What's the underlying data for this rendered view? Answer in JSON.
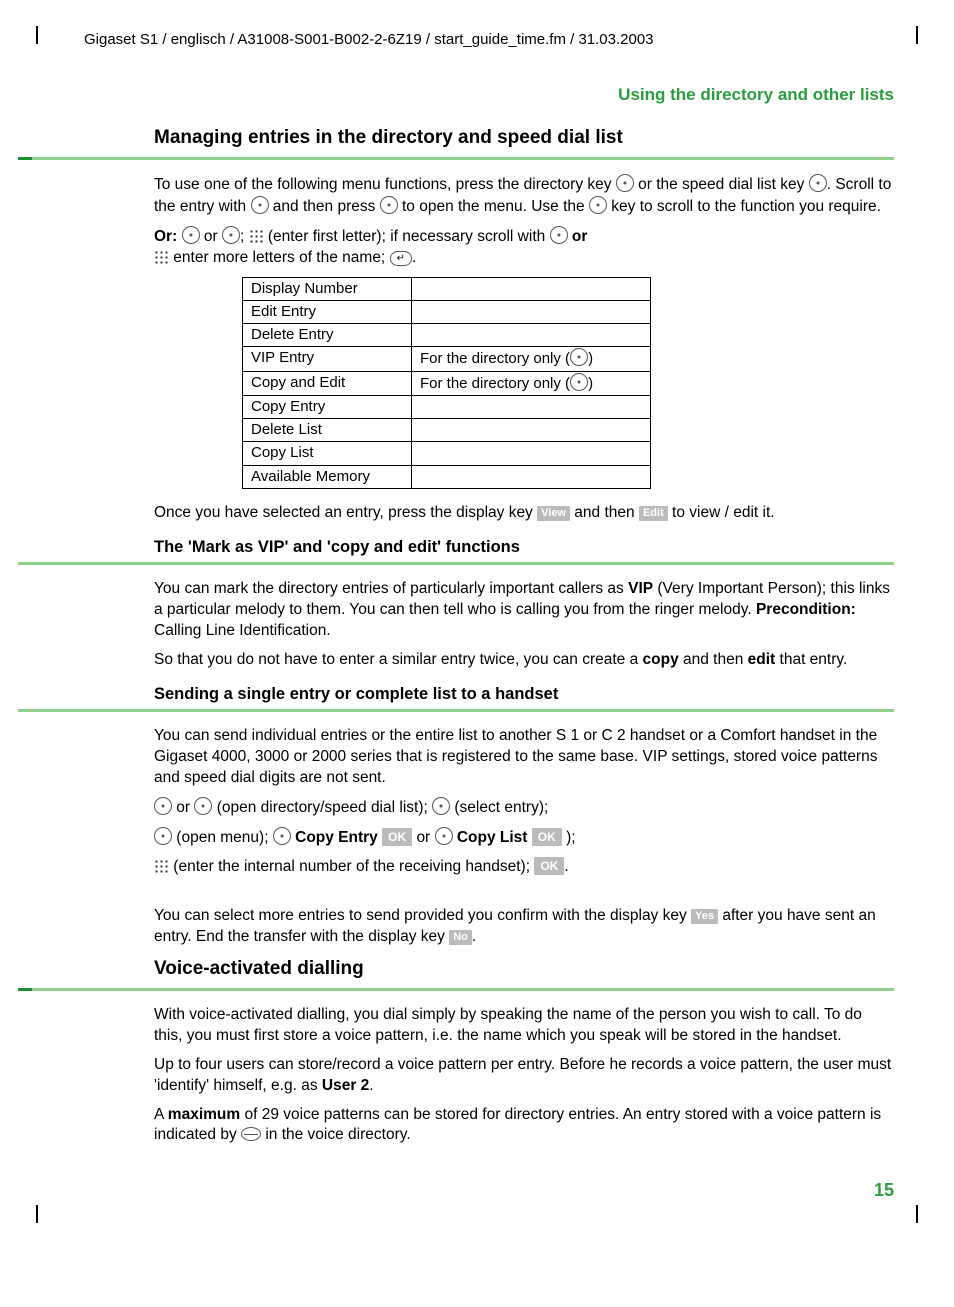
{
  "header_path": "Gigaset S1 / englisch / A31008-S001-B002-2-6Z19 / start_guide_time.fm / 31.03.2003",
  "section_title": "Using the directory and other lists",
  "h1": "Managing entries in the directory and speed dial list",
  "p1a": "To use one of the following menu functions, press the directory key ",
  "p1b": " or the speed dial list key ",
  "p1c": ". Scroll to the entry with ",
  "p1d": " and then press ",
  "p1e": " to open the menu. Use the ",
  "p1f": " key to scroll to the function you require.",
  "p2_or": "Or:",
  "p2a": " or ",
  "p2b": "; ",
  "p2c": " (enter first letter); if necessary scroll with ",
  "p2d": " or",
  "p3a": " enter more letters of the name; ",
  "table": {
    "rows": [
      {
        "c1": "Display Number",
        "c2": ""
      },
      {
        "c1": "Edit Entry",
        "c2": ""
      },
      {
        "c1": "Delete Entry",
        "c2": ""
      },
      {
        "c1": "VIP Entry",
        "c2": "For the directory only ("
      },
      {
        "c1": "Copy and Edit",
        "c2": "For the directory only ("
      },
      {
        "c1": "Copy Entry",
        "c2": ""
      },
      {
        "c1": "Delete List",
        "c2": ""
      },
      {
        "c1": "Copy List",
        "c2": ""
      },
      {
        "c1": "Available Memory",
        "c2": ""
      }
    ]
  },
  "p4a": "Once you have selected an entry, press the display key ",
  "p4_view": "View",
  "p4b": " and then ",
  "p4_edit": "Edit",
  "p4c": " to view / edit it.",
  "h2": "The 'Mark as VIP' and 'copy and edit' functions",
  "p5a": "You can mark the directory entries of particularly important callers as ",
  "p5_vip": "VIP",
  "p5b": " (Very Important Person); this links a particular melody to them. You can then tell who is calling you from the ringer melody. ",
  "p5_pre": "Precondition:",
  "p5c": " Calling Line Identification.",
  "p6a": "So that you do not have to enter a similar entry twice, you can create a ",
  "p6_copy": "copy",
  "p6b": " and then ",
  "p6_edit": "edit",
  "p6c": " that entry.",
  "h3": "Sending a single entry or complete list to a handset",
  "p7": "You can send individual entries or the entire list to another S 1 or C 2 handset or a Comfort handset in the Gigaset 4000, 3000 or 2000 series that is registered to the same base. VIP settings, stored voice patterns and speed dial digits are not sent.",
  "p8a": " or ",
  "p8b": " (open directory/speed dial list); ",
  "p8c": " (select entry);",
  "p9a": " (open menu); ",
  "p9_ce": "Copy Entry",
  "p9_ok": "OK",
  "p9b": " or ",
  "p9_cl": "Copy List",
  "p9c": " );",
  "p10a": " (enter the internal number of the receiving handset); ",
  "p10b": ".",
  "p11a": "You can select more entries to send provided you confirm with the display key ",
  "p11_yes": "Yes",
  "p11b": " after you have sent an entry. End the transfer with the display key ",
  "p11_no": "No",
  "p11c": ".",
  "h4": "Voice-activated dialling",
  "p12": "With voice-activated dialling, you dial simply by speaking the name of the person you wish to call. To do this, you must first store a voice pattern, i.e. the name which you speak will be stored in the handset.",
  "p13a": "Up to four users can store/record a voice pattern per entry. Before he records a voice pattern, the user must 'identify' himself, e.g. as ",
  "p13_user": "User 2",
  "p13b": ".",
  "p14a": "A ",
  "p14_max": "maximum",
  "p14b": " of 29 voice patterns can be stored for directory entries. An entry stored with a voice pattern is indicated by ",
  "p14c": " in the voice directory.",
  "page_number": "15"
}
